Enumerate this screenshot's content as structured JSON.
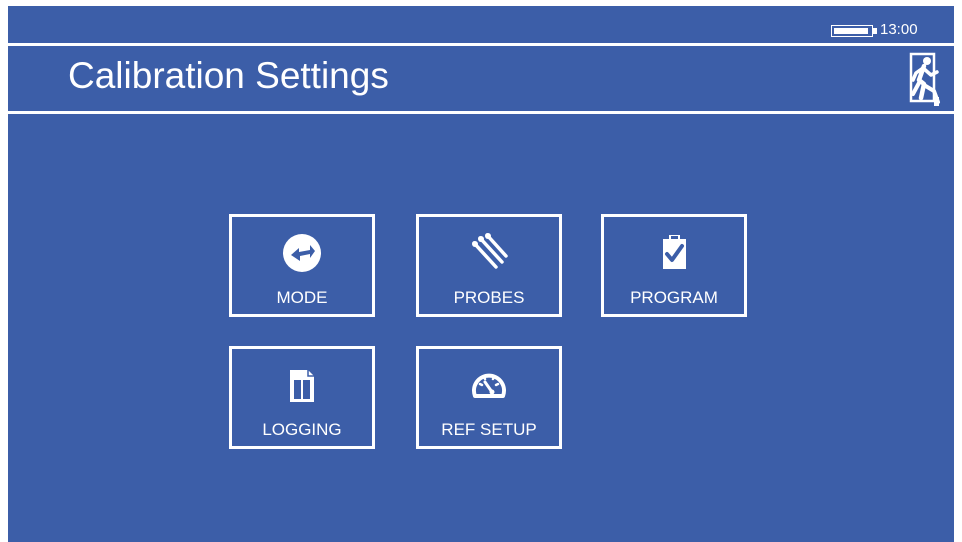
{
  "status_bar": {
    "battery_level": 0.95,
    "clock": "13:00"
  },
  "header": {
    "title": "Calibration Settings",
    "exit_icon": "exit-running-man-icon"
  },
  "menu": {
    "tiles": [
      {
        "label": "MODE",
        "icon": "swap-arrows-icon"
      },
      {
        "label": "PROBES",
        "icon": "probes-icon"
      },
      {
        "label": "PROGRAM",
        "icon": "clipboard-check-icon"
      },
      {
        "label": "LOGGING",
        "icon": "log-book-icon"
      },
      {
        "label": "REF SETUP",
        "icon": "gauge-icon"
      }
    ]
  },
  "colors": {
    "background": "#3c5ea8",
    "foreground": "#ffffff"
  }
}
